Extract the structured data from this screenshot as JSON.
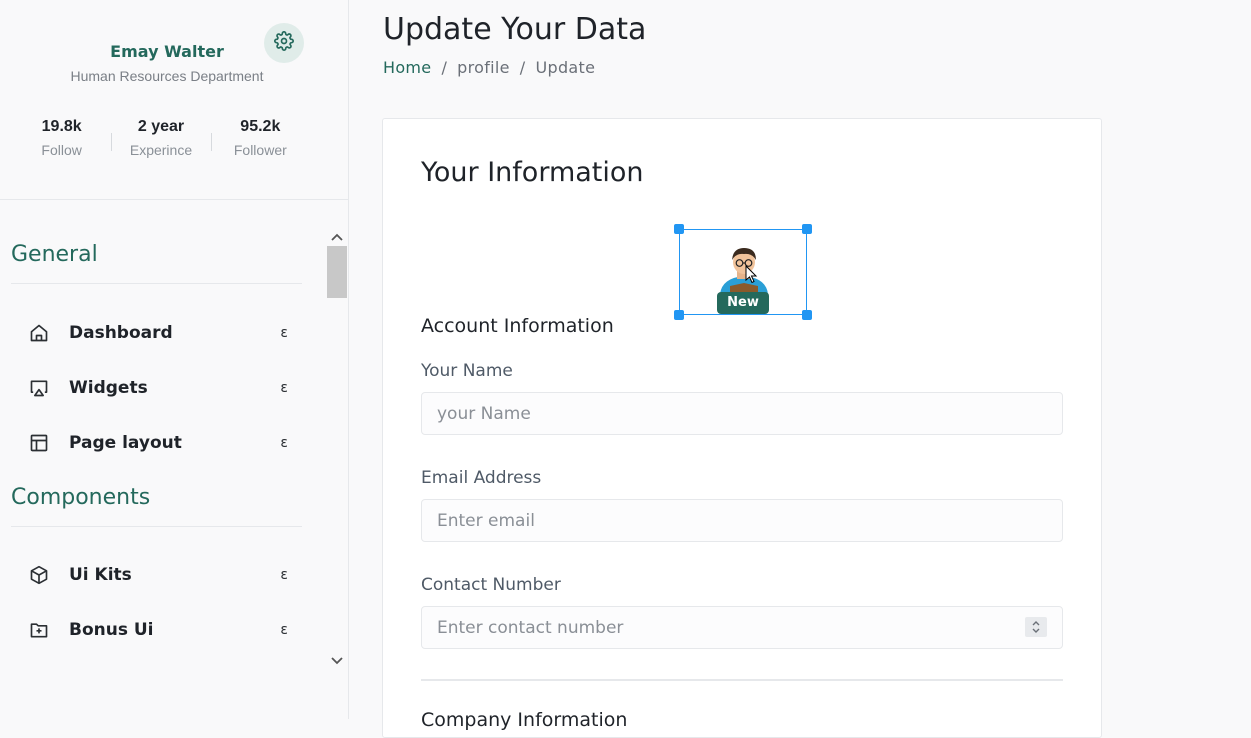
{
  "profile": {
    "name": "Emay Walter",
    "department": "Human Resources Department",
    "stats": [
      {
        "value": "19.8k",
        "label": "Follow"
      },
      {
        "value": "2 year",
        "label": "Experince"
      },
      {
        "value": "95.2k",
        "label": "Follower"
      }
    ]
  },
  "sidebar": {
    "sections": [
      {
        "title": "General",
        "items": [
          {
            "label": "Dashboard",
            "icon": "home-icon",
            "arrow": "ε"
          },
          {
            "label": "Widgets",
            "icon": "monitor-icon",
            "arrow": "ε"
          },
          {
            "label": "Page layout",
            "icon": "layout-icon",
            "arrow": "ε"
          }
        ]
      },
      {
        "title": "Components",
        "items": [
          {
            "label": "Ui Kits",
            "icon": "box-icon",
            "arrow": "ε"
          },
          {
            "label": "Bonus Ui",
            "icon": "folder-plus-icon",
            "arrow": "ε"
          }
        ]
      }
    ]
  },
  "header": {
    "title": "Update Your Data",
    "breadcrumb": [
      "Home",
      "profile",
      "Update"
    ],
    "separator": "/"
  },
  "card": {
    "title": "Your Information",
    "badge": "New",
    "section_heading": "Account Information",
    "fields": [
      {
        "label": "Your Name",
        "placeholder": "your Name",
        "value": ""
      },
      {
        "label": "Email Address",
        "placeholder": "Enter email",
        "value": ""
      },
      {
        "label": "Contact Number",
        "placeholder": "Enter contact number",
        "value": ""
      }
    ],
    "next_heading": "Company Information"
  },
  "colors": {
    "accent": "#24695c",
    "selection": "#2196f3"
  }
}
